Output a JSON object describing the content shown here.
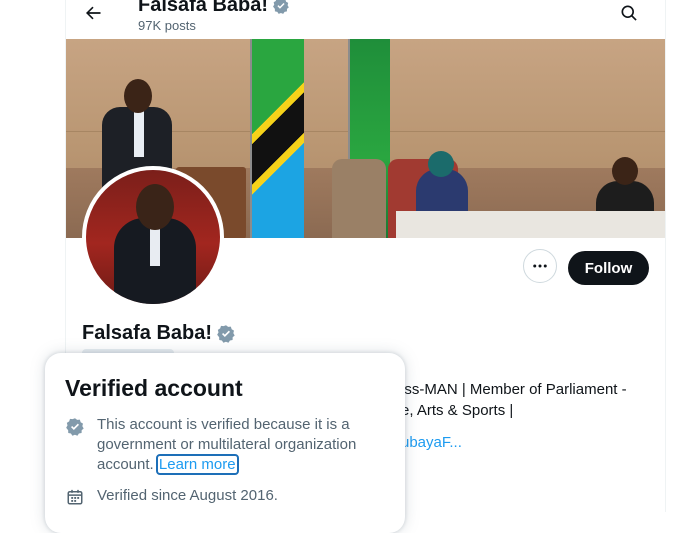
{
  "header": {
    "title": "Falsafa Baba!",
    "posts": "97K posts"
  },
  "profile": {
    "name": "Falsafa Baba!",
    "follow_label": "Follow",
    "bio_line1": "ess-MAN | Member of Parliament -",
    "bio_line2": "re, Arts & Sports |",
    "link_text": "-ubayaF..."
  },
  "popover": {
    "title": "Verified account",
    "text_before_link": "This account is verified because it is a government or multilateral organization account.",
    "learn_more": "Learn more",
    "verified_since": "Verified since August 2016."
  },
  "colors": {
    "verified_badge": "#829aab",
    "link": "#1d9bf0",
    "follow_bg": "#0f1419"
  },
  "icons": {
    "back": "arrow-left-icon",
    "search": "search-icon",
    "more": "more-dots-icon",
    "verified": "verified-badge-icon",
    "calendar": "calendar-icon"
  }
}
